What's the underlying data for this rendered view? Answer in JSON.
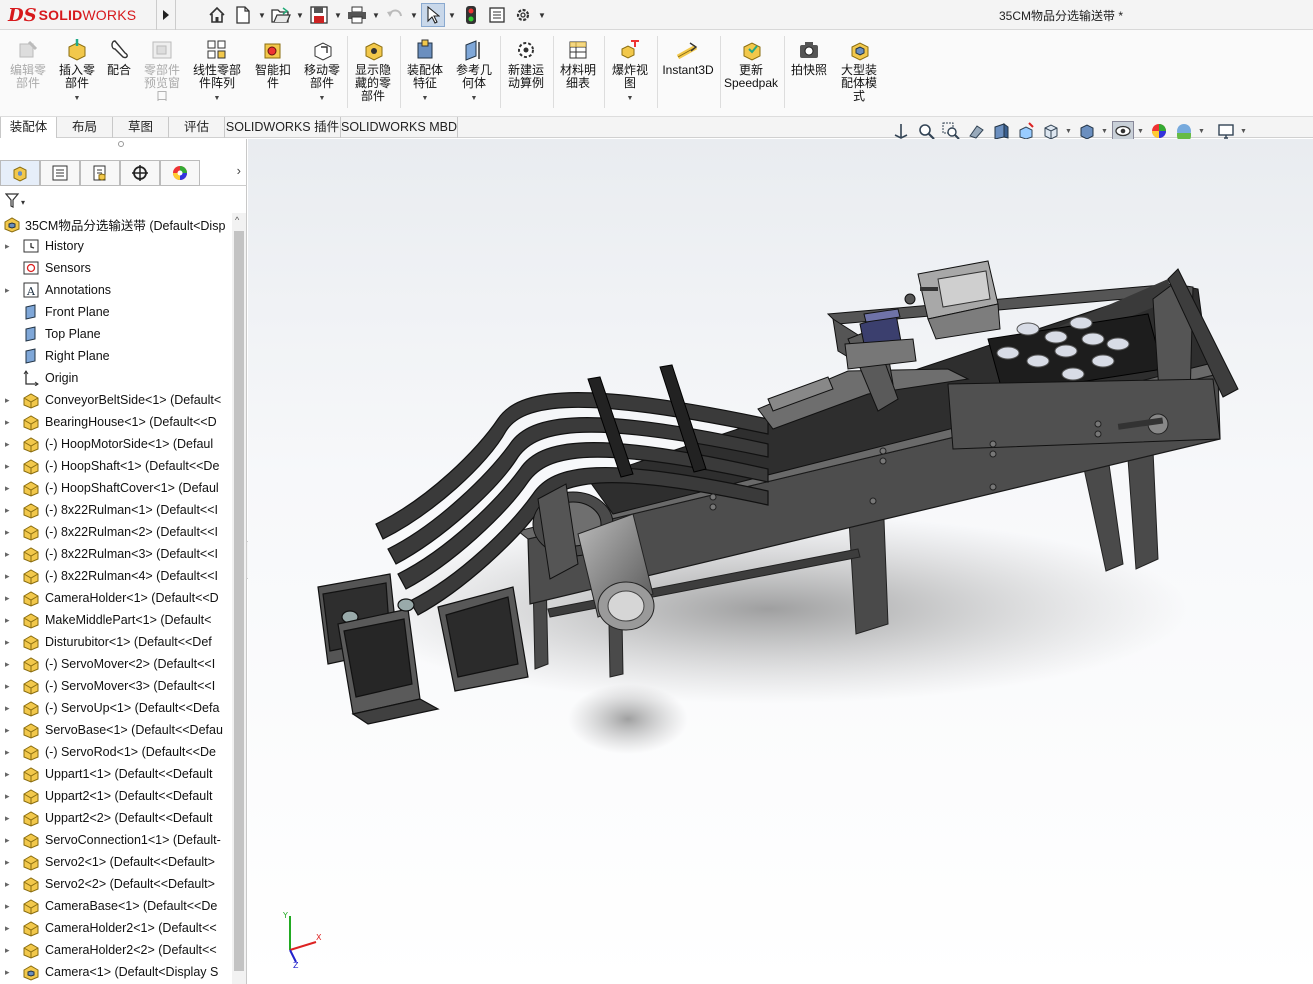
{
  "app": {
    "logo_ds": "DS",
    "logo_solid": "SOLID",
    "logo_works": "WORKS",
    "document_title": "35CM物品分选输送带 *",
    "brand_color": "#d7191c"
  },
  "quick_access": {
    "icons": [
      "home-icon",
      "new-document-icon",
      "open-icon",
      "save-icon",
      "print-icon",
      "undo-icon",
      "select-arrow-icon",
      "rebuild-icon",
      "file-properties-icon",
      "options-gear-icon"
    ]
  },
  "ribbon": {
    "buttons": [
      {
        "label": "编辑零\n部件",
        "icon": "edit-component-icon",
        "disabled": true
      },
      {
        "label": "插入零\n部件",
        "icon": "insert-component-icon",
        "disabled": false
      },
      {
        "label": "配合",
        "icon": "mate-icon",
        "disabled": false
      },
      {
        "label": "零部件\n预览窗\n口",
        "icon": "component-preview-icon",
        "disabled": true
      },
      {
        "label": "线性零部\n件阵列",
        "icon": "linear-pattern-icon",
        "disabled": false
      },
      {
        "label": "智能扣\n件",
        "icon": "smart-fasteners-icon",
        "disabled": false
      },
      {
        "label": "移动零\n部件",
        "icon": "move-component-icon",
        "disabled": false
      },
      {
        "label": "显示隐\n藏的零\n部件",
        "icon": "show-hidden-icon",
        "disabled": false
      },
      {
        "label": "装配体\n特征",
        "icon": "assembly-features-icon",
        "disabled": false
      },
      {
        "label": "参考几\n何体",
        "icon": "reference-geometry-icon",
        "disabled": false
      },
      {
        "label": "新建运\n动算例",
        "icon": "motion-study-icon",
        "disabled": false
      },
      {
        "label": "材料明\n细表",
        "icon": "bom-icon",
        "disabled": false
      },
      {
        "label": "爆炸视\n图",
        "icon": "exploded-view-icon",
        "disabled": false
      },
      {
        "label": "Instant3D",
        "icon": "instant3d-icon",
        "disabled": false
      },
      {
        "label": "更新\nSpeedpak",
        "icon": "speedpak-icon",
        "disabled": false
      },
      {
        "label": "拍快照",
        "icon": "snapshot-icon",
        "disabled": false
      },
      {
        "label": "大型装\n配体模\n式",
        "icon": "large-assembly-icon",
        "disabled": false
      }
    ]
  },
  "command_tabs": [
    "装配体",
    "布局",
    "草图",
    "评估",
    "SOLIDWORKS 插件",
    "SOLIDWORKS MBD"
  ],
  "view_toolbar": {
    "icons": [
      "view-orientation-icon",
      "zoom-to-fit-icon",
      "zoom-to-area-icon",
      "previous-view-icon",
      "section-view-icon",
      "dynamic-annotation-icon",
      "view-orientation-cube-icon",
      "display-style-icon",
      "hide-show-items-icon",
      "edit-appearance-icon",
      "apply-scene-icon",
      "view-settings-icon"
    ]
  },
  "feature_manager": {
    "tabs": [
      "featuremanager-tree-icon",
      "property-manager-icon",
      "configuration-manager-icon",
      "dimxpert-icon",
      "display-manager-icon"
    ],
    "root": "35CM物品分选输送带  (Default<Disp",
    "items": [
      {
        "label": "History",
        "icon": "history-icon",
        "expandable": true
      },
      {
        "label": "Sensors",
        "icon": "sensors-icon",
        "expandable": false
      },
      {
        "label": "Annotations",
        "icon": "annotations-icon",
        "expandable": true
      },
      {
        "label": "Front Plane",
        "icon": "plane-icon",
        "expandable": false
      },
      {
        "label": "Top Plane",
        "icon": "plane-icon",
        "expandable": false
      },
      {
        "label": "Right Plane",
        "icon": "plane-icon",
        "expandable": false
      },
      {
        "label": "Origin",
        "icon": "origin-icon",
        "expandable": false
      },
      {
        "label": "ConveyorBeltSide<1> (Default<",
        "icon": "assembly-icon",
        "expandable": true
      },
      {
        "label": "BearingHouse<1> (Default<<D",
        "icon": "assembly-icon",
        "expandable": true
      },
      {
        "label": "(-) HoopMotorSide<1> (Defaul",
        "icon": "assembly-icon",
        "expandable": true
      },
      {
        "label": "(-) HoopShaft<1> (Default<<De",
        "icon": "assembly-icon",
        "expandable": true
      },
      {
        "label": "(-) HoopShaftCover<1> (Defaul",
        "icon": "assembly-icon",
        "expandable": true
      },
      {
        "label": "(-) 8x22Rulman<1> (Default<<I",
        "icon": "assembly-icon",
        "expandable": true
      },
      {
        "label": "(-) 8x22Rulman<2> (Default<<I",
        "icon": "assembly-icon",
        "expandable": true
      },
      {
        "label": "(-) 8x22Rulman<3> (Default<<I",
        "icon": "assembly-icon",
        "expandable": true
      },
      {
        "label": "(-) 8x22Rulman<4> (Default<<I",
        "icon": "assembly-icon",
        "expandable": true
      },
      {
        "label": "CameraHolder<1> (Default<<D",
        "icon": "assembly-icon",
        "expandable": true
      },
      {
        "label": "MakeMiddlePart<1> (Default<",
        "icon": "assembly-icon",
        "expandable": true
      },
      {
        "label": "Disturubitor<1> (Default<<Def",
        "icon": "assembly-icon",
        "expandable": true
      },
      {
        "label": "(-) ServoMover<2> (Default<<I",
        "icon": "assembly-icon",
        "expandable": true
      },
      {
        "label": "(-) ServoMover<3> (Default<<I",
        "icon": "assembly-icon",
        "expandable": true
      },
      {
        "label": "(-) ServoUp<1> (Default<<Defa",
        "icon": "assembly-icon",
        "expandable": true
      },
      {
        "label": "ServoBase<1> (Default<<Defau",
        "icon": "assembly-icon",
        "expandable": true
      },
      {
        "label": "(-) ServoRod<1> (Default<<De",
        "icon": "assembly-icon",
        "expandable": true
      },
      {
        "label": "Uppart1<1> (Default<<Default",
        "icon": "assembly-icon",
        "expandable": true
      },
      {
        "label": "Uppart2<1> (Default<<Default",
        "icon": "assembly-icon",
        "expandable": true
      },
      {
        "label": "Uppart2<2> (Default<<Default",
        "icon": "assembly-icon",
        "expandable": true
      },
      {
        "label": "ServoConnection1<1> (Default-",
        "icon": "assembly-icon",
        "expandable": true
      },
      {
        "label": "Servo2<1> (Default<<Default>",
        "icon": "assembly-icon",
        "expandable": true
      },
      {
        "label": "Servo2<2> (Default<<Default>",
        "icon": "assembly-icon",
        "expandable": true
      },
      {
        "label": "CameraBase<1> (Default<<De",
        "icon": "assembly-icon",
        "expandable": true
      },
      {
        "label": "CameraHolder2<1> (Default<<",
        "icon": "assembly-icon",
        "expandable": true
      },
      {
        "label": "CameraHolder2<2> (Default<<",
        "icon": "assembly-icon",
        "expandable": true
      },
      {
        "label": "Camera<1> (Default<Display S",
        "icon": "sub-assembly-icon",
        "expandable": true
      }
    ]
  },
  "viewport": {
    "model": "conveyor-belt-assembly",
    "triad_axes": [
      "X",
      "Y",
      "Z"
    ],
    "triad_colors": {
      "x": "#d22",
      "y": "#2a2",
      "z": "#22c"
    }
  }
}
